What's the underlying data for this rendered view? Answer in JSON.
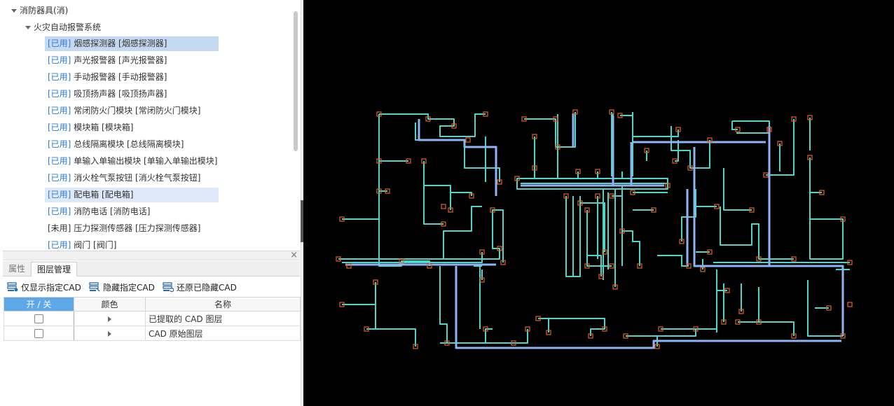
{
  "tree": {
    "root_label": "消防器具(消)",
    "group_label": "火灾自动报警系统",
    "items": [
      {
        "tag": "[已用]",
        "label": "烟感探测器 [烟感探测器]",
        "state": "selected"
      },
      {
        "tag": "[已用]",
        "label": "声光报警器 [声光报警器]",
        "state": ""
      },
      {
        "tag": "[已用]",
        "label": "手动报警器 [手动报警器]",
        "state": ""
      },
      {
        "tag": "[已用]",
        "label": "吸顶扬声器 [吸顶扬声器]",
        "state": ""
      },
      {
        "tag": "[已用]",
        "label": "常闭防火门模块 [常闭防火门模块]",
        "state": ""
      },
      {
        "tag": "[已用]",
        "label": "模块箱 [模块箱]",
        "state": ""
      },
      {
        "tag": "[已用]",
        "label": "总线隔离模块 [总线隔离模块]",
        "state": ""
      },
      {
        "tag": "[已用]",
        "label": "单输入单输出模块 [单输入单输出模块]",
        "state": ""
      },
      {
        "tag": "[已用]",
        "label": "消火栓气泵按钮 [消火栓气泵按钮]",
        "state": ""
      },
      {
        "tag": "[已用]",
        "label": "配电箱 [配电箱]",
        "state": "hover"
      },
      {
        "tag": "[已用]",
        "label": "消防电话 [消防电话]",
        "state": ""
      },
      {
        "tag": "[未用]",
        "label": "压力探测传感器 [压力探测传感器]",
        "state": ""
      },
      {
        "tag": "[已用]",
        "label": "阀门 [阀门]",
        "state": ""
      }
    ]
  },
  "panel": {
    "close_glyph": "×",
    "tabs": [
      {
        "label": "属性",
        "active": false
      },
      {
        "label": "图层管理",
        "active": true
      }
    ]
  },
  "toolbar": {
    "show_only_label": "仅显示指定CAD",
    "hide_label": "隐藏指定CAD",
    "restore_label": "还原已隐藏CAD"
  },
  "layer_table": {
    "headers": {
      "onoff": "开 / 关",
      "color": "颜色",
      "name": "名称"
    },
    "rows": [
      {
        "checked": false,
        "name": "已提取的 CAD 图层"
      },
      {
        "checked": false,
        "name": "CAD 原始图层"
      }
    ]
  },
  "colors": {
    "canvas_bg": "#000000",
    "wire": "#4fd6c8",
    "bus": "#8fb4f2",
    "device": "#e0642a",
    "selected_row": "#c5daf2",
    "active_header": "#5fa8e8",
    "used_tag": "#2b7bd6"
  }
}
